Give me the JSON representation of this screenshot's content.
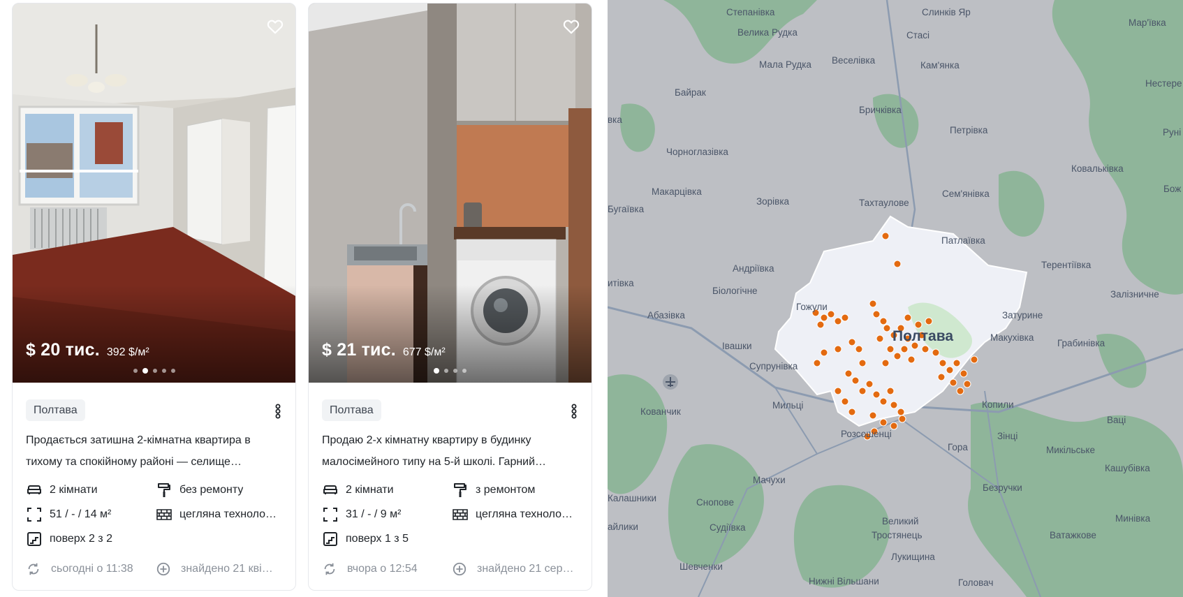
{
  "listings": [
    {
      "price": "$ 20 тис.",
      "price_per_m2": "392 $/м²",
      "city": "Полтава",
      "description_line1": "Продається затишна 2-кімнатна квартира в",
      "description_line2": "тихому та спокійному районі — селище…",
      "rooms": "2 кімнати",
      "renovation": "без ремонту",
      "area": "51 / - / 14 м²",
      "building_type": "цегляна техноло…",
      "floor": "поверх 2 з 2",
      "updated": "сьогодні о 11:38",
      "found": "знайдено 21 кві…",
      "photo_count": 5,
      "active_photo": 2
    },
    {
      "price": "$ 21 тис.",
      "price_per_m2": "677 $/м²",
      "city": "Полтава",
      "description_line1": "Продаю 2-х кімнатну квартиру в будинку",
      "description_line2": "малосімейного типу на 5-й школі. Гарний…",
      "rooms": "2 кімнати",
      "renovation": "з ремонтом",
      "area": "31 / - / 9 м²",
      "building_type": "цегляна техноло…",
      "floor": "поверх 1 з 5",
      "updated": "вчора о 12:54",
      "found": "знайдено 21 сер…",
      "photo_count": 4,
      "active_photo": 1
    }
  ],
  "icons": {
    "favorite": "heart-icon",
    "more": "more-vertical-icon",
    "rooms": "sofa-icon",
    "renovation": "paint-roller-icon",
    "area": "area-icon",
    "building": "brick-wall-icon",
    "floor": "stairs-icon",
    "updated": "refresh-icon",
    "found": "plus-circle-icon"
  },
  "map": {
    "city_label": "Полтава",
    "place_labels": [
      "Степанівка",
      "Слинків Яр",
      "Мар'ївка",
      "Велика Рудка",
      "Стасі",
      "Мала Рудка",
      "Веселівка",
      "Кам'янка",
      "Нестере",
      "Байрак",
      "Бричківка",
      "вка",
      "Петрівка",
      "Руні",
      "Чорноглазівка",
      "Ковальківка",
      "Макарцівка",
      "Зорівка",
      "Тахтаулове",
      "Сем'янівка",
      "Бож",
      "Бугаївка",
      "Патлаївка",
      "Андріївка",
      "Терентіївка",
      "итівка",
      "Біологічне",
      "Залізничне",
      "Гожули",
      "Абазівка",
      "Затурине",
      "Макухівка",
      "Івашки",
      "Грабинівка",
      "Супрунівка",
      "Кованчик",
      "Мильці",
      "Копили",
      "Розсошенці",
      "Ваці",
      "Зінці",
      "Гора",
      "Микільське",
      "Кашубівка",
      "Мачухи",
      "Калашники",
      "Снопове",
      "Безручки",
      "Минівка",
      "айлики",
      "Судіївка",
      "Великий",
      "Тростянець",
      "Ватажкове",
      "Лукищина",
      "Шевченки",
      "Нижні Вільшани",
      "Головач"
    ],
    "colors": {
      "land": "#bdbfc4",
      "forest": "#8fb59a",
      "city_area": "#eef0f6",
      "marker": "#e36a10",
      "road": "#8c9bb0"
    }
  }
}
